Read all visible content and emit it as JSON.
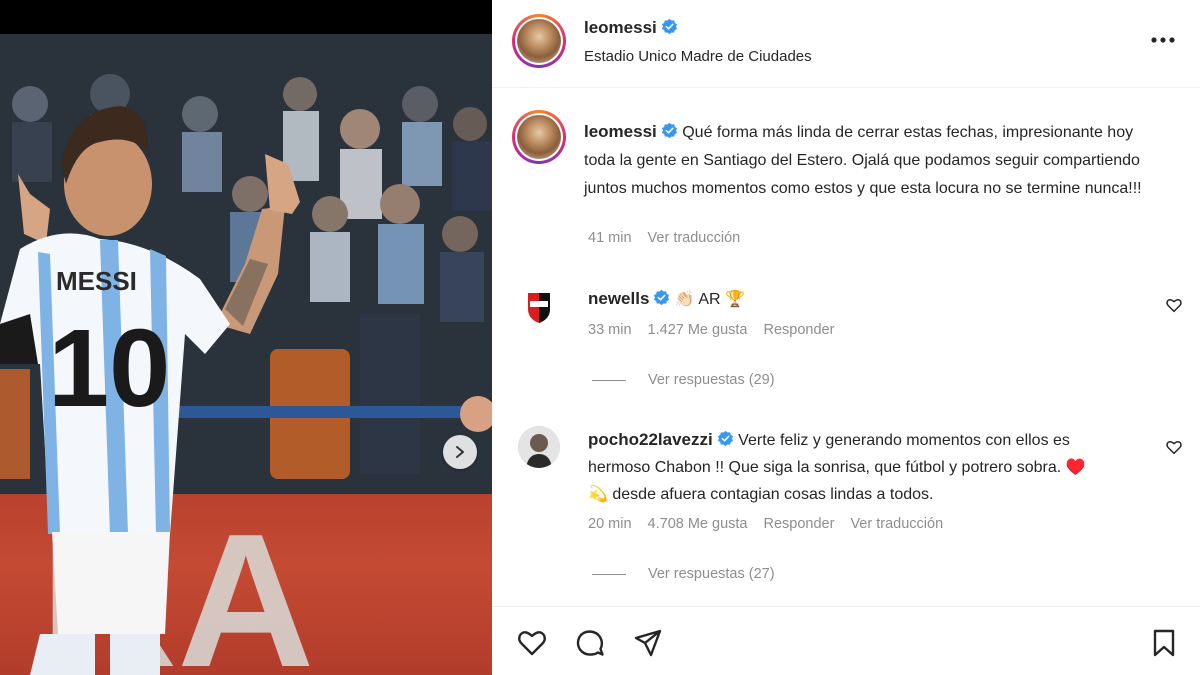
{
  "post": {
    "author": "leomessi",
    "location": "Estadio Unico Madre de Ciudades",
    "caption": "Qué forma más linda de cerrar estas fechas, impresionante hoy toda la gente en Santiago del Estero. Ojalá que podamos seguir compartiendo juntos muchos momentos como estos y que esta locura no se termine nunca!!!",
    "time": "41 min",
    "translate": "Ver traducción"
  },
  "photo": {
    "jersey_name": "MESSI",
    "jersey_number": "10",
    "board_text": "RA"
  },
  "comments": [
    {
      "user": "newells",
      "text": "👏🏻 AR 🏆",
      "time": "33 min",
      "likes": "1.427 Me gusta",
      "reply": "Responder",
      "view_replies": "Ver respuestas (29)"
    },
    {
      "user": "pocho22lavezzi",
      "text": "Verte feliz y generando momentos con ellos es hermoso Chabon !! Que siga la sonrisa, que fútbol y potrero sobra. ♥️ 💫 desde afuera contagian cosas lindas a todos.",
      "time": "20 min",
      "likes": "4.708 Me gusta",
      "reply": "Responder",
      "translate": "Ver traducción",
      "view_replies": "Ver respuestas (27)"
    }
  ],
  "icons": {
    "verified": "verified-badge-icon",
    "more": "more-options-icon",
    "like": "heart-icon",
    "comment": "comment-icon",
    "share": "paper-plane-icon",
    "save": "bookmark-icon",
    "next": "chevron-right-icon"
  },
  "colors": {
    "verified_blue": "#3897f0",
    "muted_text": "#8e8e8e",
    "text": "#262626"
  }
}
